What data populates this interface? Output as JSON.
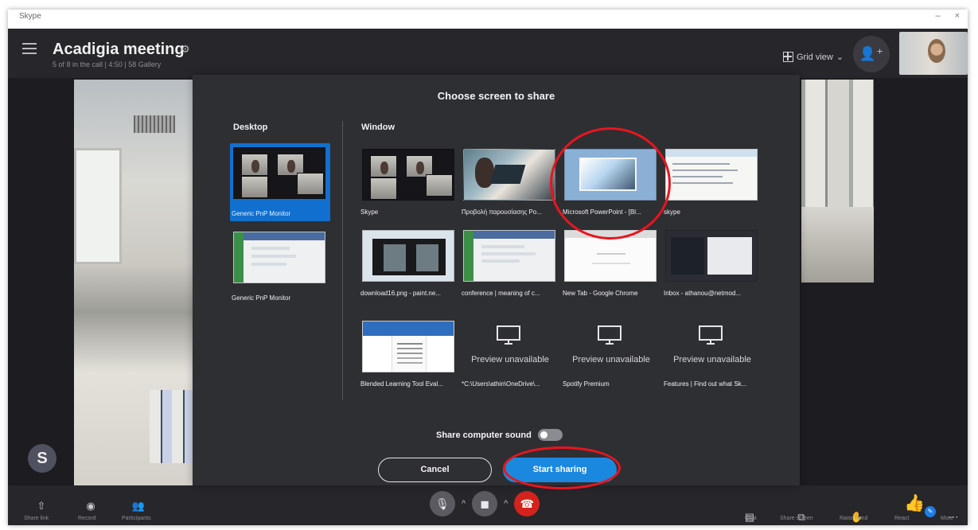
{
  "window": {
    "title": "Skype",
    "controls": [
      "–",
      "×"
    ]
  },
  "header": {
    "meeting_title": "Acadigia meeting",
    "meeting_subtitle": "5 of 8 in the call | 4:50 | 58 Gallery",
    "grid_view_label": "Grid view",
    "grid_view_chevron": "⌄",
    "add_person_icon": "person-plus-icon"
  },
  "dialog": {
    "title": "Choose screen to share",
    "desktop_section": "Desktop",
    "window_section": "Window",
    "desktop_items": [
      {
        "label": "Generic PnP Monitor",
        "selected": true
      },
      {
        "label": "Generic PnP Monitor",
        "selected": false
      }
    ],
    "window_items": [
      {
        "label": "Skype",
        "preview": "available"
      },
      {
        "label": "Προβολή παρουσίασης Po...",
        "preview": "available"
      },
      {
        "label": "Microsoft PowerPoint - [Bl...",
        "preview": "available"
      },
      {
        "label": "skype",
        "preview": "available"
      },
      {
        "label": "download16.png - paint.ne...",
        "preview": "available"
      },
      {
        "label": "conference | meaning of c...",
        "preview": "available"
      },
      {
        "label": "New Tab - Google Chrome",
        "preview": "available"
      },
      {
        "label": "Inbox - athanou@netmod...",
        "preview": "available"
      },
      {
        "label": "Blended Learning Tool Eval...",
        "preview": "available"
      },
      {
        "label": "*C:\\Users\\athin\\OneDrive\\...",
        "preview": "Preview unavailable"
      },
      {
        "label": "Spotify Premium",
        "preview": "Preview unavailable"
      },
      {
        "label": "Features | Find out what Sk...",
        "preview": "Preview unavailable"
      }
    ],
    "share_sound_label": "Share computer sound",
    "share_sound_enabled": false,
    "cancel_label": "Cancel",
    "start_label": "Start sharing"
  },
  "bottom_bar": {
    "left_icons": [
      "share-icon",
      "record-icon",
      "participants-icon"
    ],
    "left_labels": [
      "Share link",
      "Record",
      "Participants"
    ],
    "right_icons": [
      "chat-icon",
      "screen-share-icon",
      "raise-hand-icon",
      "react-icon",
      "more-icon"
    ],
    "right_labels": [
      "Chat",
      "Share screen",
      "Raise hand",
      "React",
      "More"
    ]
  },
  "colors": {
    "accent": "#1b88df",
    "annotation": "#e8151f",
    "dialog_bg": "#2e2f33",
    "call_bg": "#26262b",
    "end_call": "#d4231d"
  }
}
